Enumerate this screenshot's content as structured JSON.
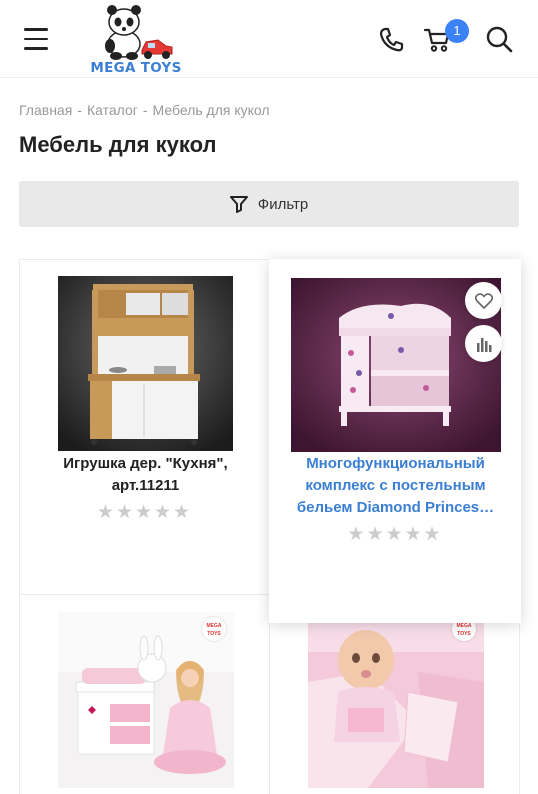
{
  "header": {
    "logo_text": "MEGA TOYS",
    "cart_count": "1"
  },
  "breadcrumb": [
    "Главная",
    "Каталог",
    "Мебель для кукол"
  ],
  "page_title": "Мебель для кукол",
  "filter": {
    "label": "Фильтр"
  },
  "products": [
    {
      "name": "Игрушка дер. \"Кухня\", арт.11211",
      "rating": 0
    },
    {
      "name": "Многофункциональный комплекс с постельным бельем Diamond Princes…",
      "rating": 0
    },
    {
      "name": "",
      "rating": 0,
      "badge": "MEGA TOYS"
    },
    {
      "name": "",
      "rating": 0,
      "badge": "MEGA TOYS"
    }
  ],
  "colors": {
    "accent": "#3b82f6",
    "link": "#3b7fd4",
    "filter_bg": "#e9e9e9"
  },
  "icons": [
    "menu-icon",
    "phone-icon",
    "cart-icon",
    "search-icon",
    "filter-icon",
    "heart-icon",
    "compare-icon",
    "star-icon"
  ]
}
